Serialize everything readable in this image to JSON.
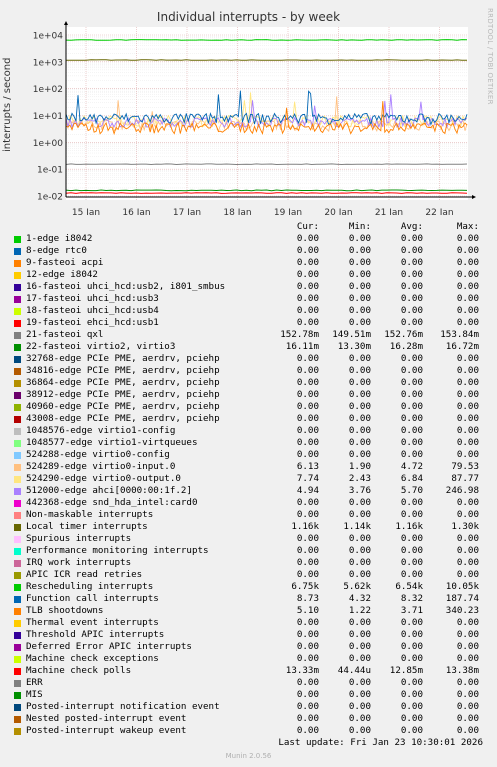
{
  "side_text": "RRDTOOL / TOBI OETIKER",
  "footer": "Munin 2.0.56",
  "last_update": "Last update: Fri Jan 23 10:30:01 2026",
  "legend_header": {
    "cur": "Cur:",
    "min": "Min:",
    "avg": "Avg:",
    "max": "Max:"
  },
  "chart_data": {
    "type": "line",
    "title": "Individual interrupts - by week",
    "ylabel": "interrupts / second",
    "yscale": "log",
    "ylim": [
      0.01,
      10000
    ],
    "yticks": [
      "1e-02",
      "1e-01",
      "1e+00",
      "1e+01",
      "1e+02",
      "1e+03",
      "1e+04"
    ],
    "x_ticks": [
      "15 Jan",
      "16 Jan",
      "17 Jan",
      "18 Jan",
      "19 Jan",
      "20 Jan",
      "21 Jan",
      "22 Jan"
    ],
    "grid": true,
    "series": [
      {
        "name": "1-edge i8042",
        "color": "#00cc00",
        "cur": "0.00",
        "min": "0.00",
        "avg": "0.00",
        "max": "0.00"
      },
      {
        "name": "8-edge rtc0",
        "color": "#0066b3",
        "cur": "0.00",
        "min": "0.00",
        "avg": "0.00",
        "max": "0.00"
      },
      {
        "name": "9-fasteoi acpi",
        "color": "#ff8000",
        "cur": "0.00",
        "min": "0.00",
        "avg": "0.00",
        "max": "0.00"
      },
      {
        "name": "12-edge i8042",
        "color": "#ffcc00",
        "cur": "0.00",
        "min": "0.00",
        "avg": "0.00",
        "max": "0.00"
      },
      {
        "name": "16-fasteoi uhci_hcd:usb2, i801_smbus",
        "color": "#330099",
        "cur": "0.00",
        "min": "0.00",
        "avg": "0.00",
        "max": "0.00"
      },
      {
        "name": "17-fasteoi uhci_hcd:usb3",
        "color": "#990099",
        "cur": "0.00",
        "min": "0.00",
        "avg": "0.00",
        "max": "0.00"
      },
      {
        "name": "18-fasteoi uhci_hcd:usb4",
        "color": "#ccff00",
        "cur": "0.00",
        "min": "0.00",
        "avg": "0.00",
        "max": "0.00"
      },
      {
        "name": "19-fasteoi ehci_hcd:usb1",
        "color": "#ff0000",
        "cur": "0.00",
        "min": "0.00",
        "avg": "0.00",
        "max": "0.00"
      },
      {
        "name": "21-fasteoi qxl",
        "color": "#808080",
        "cur": "152.78m",
        "min": "149.51m",
        "avg": "152.76m",
        "max": "153.84m"
      },
      {
        "name": "22-fasteoi virtio2, virtio3",
        "color": "#008f00",
        "cur": "16.11m",
        "min": "13.30m",
        "avg": "16.28m",
        "max": "16.72m"
      },
      {
        "name": "32768-edge PCIe PME, aerdrv, pciehp",
        "color": "#00487d",
        "cur": "0.00",
        "min": "0.00",
        "avg": "0.00",
        "max": "0.00"
      },
      {
        "name": "34816-edge PCIe PME, aerdrv, pciehp",
        "color": "#b35a00",
        "cur": "0.00",
        "min": "0.00",
        "avg": "0.00",
        "max": "0.00"
      },
      {
        "name": "36864-edge PCIe PME, aerdrv, pciehp",
        "color": "#b38f00",
        "cur": "0.00",
        "min": "0.00",
        "avg": "0.00",
        "max": "0.00"
      },
      {
        "name": "38912-edge PCIe PME, aerdrv, pciehp",
        "color": "#6b006b",
        "cur": "0.00",
        "min": "0.00",
        "avg": "0.00",
        "max": "0.00"
      },
      {
        "name": "40960-edge PCIe PME, aerdrv, pciehp",
        "color": "#8fb300",
        "cur": "0.00",
        "min": "0.00",
        "avg": "0.00",
        "max": "0.00"
      },
      {
        "name": "43008-edge PCIe PME, aerdrv, pciehp",
        "color": "#b30000",
        "cur": "0.00",
        "min": "0.00",
        "avg": "0.00",
        "max": "0.00"
      },
      {
        "name": "1048576-edge virtio1-config",
        "color": "#bebebe",
        "cur": "0.00",
        "min": "0.00",
        "avg": "0.00",
        "max": "0.00"
      },
      {
        "name": "1048577-edge virtio1-virtqueues",
        "color": "#80ff80",
        "cur": "0.00",
        "min": "0.00",
        "avg": "0.00",
        "max": "0.00"
      },
      {
        "name": "524288-edge virtio0-config",
        "color": "#80c9ff",
        "cur": "0.00",
        "min": "0.00",
        "avg": "0.00",
        "max": "0.00"
      },
      {
        "name": "524289-edge virtio0-input.0",
        "color": "#ffc080",
        "cur": "6.13",
        "min": "1.90",
        "avg": "4.72",
        "max": "79.53"
      },
      {
        "name": "524290-edge virtio0-output.0",
        "color": "#ffe680",
        "cur": "7.74",
        "min": "2.43",
        "avg": "6.84",
        "max": "87.77"
      },
      {
        "name": "512000-edge ahci[0000:00:1f.2]",
        "color": "#aa80ff",
        "cur": "4.94",
        "min": "3.76",
        "avg": "5.70",
        "max": "246.98"
      },
      {
        "name": "442368-edge snd_hda_intel:card0",
        "color": "#ee00cc",
        "cur": "0.00",
        "min": "0.00",
        "avg": "0.00",
        "max": "0.00"
      },
      {
        "name": "Non-maskable interrupts",
        "color": "#ff8080",
        "cur": "0.00",
        "min": "0.00",
        "avg": "0.00",
        "max": "0.00"
      },
      {
        "name": "Local timer interrupts",
        "color": "#666600",
        "cur": "1.16k",
        "min": "1.14k",
        "avg": "1.16k",
        "max": "1.30k"
      },
      {
        "name": "Spurious interrupts",
        "color": "#ffbfff",
        "cur": "0.00",
        "min": "0.00",
        "avg": "0.00",
        "max": "0.00"
      },
      {
        "name": "Performance monitoring interrupts",
        "color": "#00ffcc",
        "cur": "0.00",
        "min": "0.00",
        "avg": "0.00",
        "max": "0.00"
      },
      {
        "name": "IRQ work interrupts",
        "color": "#cc6699",
        "cur": "0.00",
        "min": "0.00",
        "avg": "0.00",
        "max": "0.00"
      },
      {
        "name": "APIC ICR read retries",
        "color": "#999900",
        "cur": "0.00",
        "min": "0.00",
        "avg": "0.00",
        "max": "0.00"
      },
      {
        "name": "Rescheduling interrupts",
        "color": "#00cc00",
        "cur": "6.75k",
        "min": "5.62k",
        "avg": "6.54k",
        "max": "10.05k"
      },
      {
        "name": "Function call interrupts",
        "color": "#0066b3",
        "cur": "8.73",
        "min": "4.32",
        "avg": "8.32",
        "max": "187.74"
      },
      {
        "name": "TLB shootdowns",
        "color": "#ff8000",
        "cur": "5.10",
        "min": "1.22",
        "avg": "3.71",
        "max": "340.23"
      },
      {
        "name": "Thermal event interrupts",
        "color": "#ffcc00",
        "cur": "0.00",
        "min": "0.00",
        "avg": "0.00",
        "max": "0.00"
      },
      {
        "name": "Threshold APIC interrupts",
        "color": "#330099",
        "cur": "0.00",
        "min": "0.00",
        "avg": "0.00",
        "max": "0.00"
      },
      {
        "name": "Deferred Error APIC interrupts",
        "color": "#990099",
        "cur": "0.00",
        "min": "0.00",
        "avg": "0.00",
        "max": "0.00"
      },
      {
        "name": "Machine check exceptions",
        "color": "#ccff00",
        "cur": "0.00",
        "min": "0.00",
        "avg": "0.00",
        "max": "0.00"
      },
      {
        "name": "Machine check polls",
        "color": "#ff0000",
        "cur": "13.33m",
        "min": "44.44u",
        "avg": "12.85m",
        "max": "13.38m"
      },
      {
        "name": "ERR",
        "color": "#808080",
        "cur": "0.00",
        "min": "0.00",
        "avg": "0.00",
        "max": "0.00"
      },
      {
        "name": "MIS",
        "color": "#008f00",
        "cur": "0.00",
        "min": "0.00",
        "avg": "0.00",
        "max": "0.00"
      },
      {
        "name": "Posted-interrupt notification event",
        "color": "#00487d",
        "cur": "0.00",
        "min": "0.00",
        "avg": "0.00",
        "max": "0.00"
      },
      {
        "name": "Nested posted-interrupt event",
        "color": "#b35a00",
        "cur": "0.00",
        "min": "0.00",
        "avg": "0.00",
        "max": "0.00"
      },
      {
        "name": "Posted-interrupt wakeup event",
        "color": "#b38f00",
        "cur": "0.00",
        "min": "0.00",
        "avg": "0.00",
        "max": "0.00"
      }
    ]
  }
}
